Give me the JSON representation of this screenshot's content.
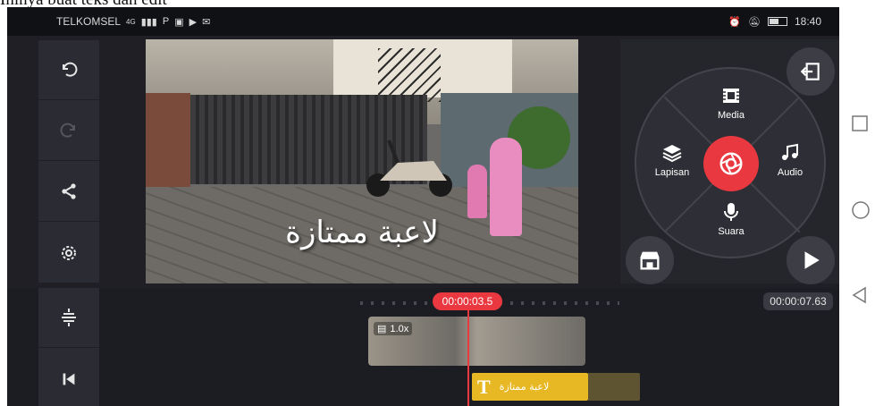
{
  "caption": "Ininya buat teks dan edit",
  "status_bar": {
    "carrier": "TELKOMSEL",
    "network": "4G",
    "time": "18:40"
  },
  "left_toolbar": {
    "icons": [
      "undo-icon",
      "redo-icon",
      "share-icon",
      "settings-icon"
    ]
  },
  "preview": {
    "overlay_text": "لاعبة ممتازة"
  },
  "wheel": {
    "items": [
      {
        "label": "Media",
        "icon": "media-icon"
      },
      {
        "label": "Lapisan",
        "icon": "layers-icon"
      },
      {
        "label": "Audio",
        "icon": "music-icon"
      },
      {
        "label": "Suara",
        "icon": "microphone-icon"
      }
    ],
    "center_icon": "camera-shutter-icon"
  },
  "timeline": {
    "current_time": "00:00:03.5",
    "total_time": "00:00:07.63",
    "clip": {
      "speed": "1.0x"
    },
    "text_layer": {
      "icon": "T",
      "label": "لاعبة ممتازة"
    }
  },
  "colors": {
    "accent": "#e9383f",
    "text_layer": "#e8b824",
    "panel": "#2b2c33"
  }
}
